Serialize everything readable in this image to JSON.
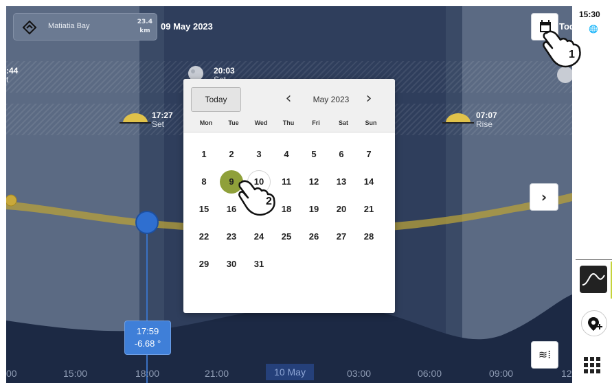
{
  "location": {
    "name": "Matiatia Bay",
    "distance_value": "23.4",
    "distance_unit": "km"
  },
  "header": {
    "date": "09 May 2023",
    "calendar_button_label": "Today"
  },
  "events": {
    "left_cut_time": ":44",
    "left_cut_label": "t",
    "moon_set_time": "20:03",
    "moon_set_label": "Set",
    "sun_set_time": "17:27",
    "sun_set_label": "Set",
    "sun_rise_time": "07:07",
    "sun_rise_label": "Rise"
  },
  "marker": {
    "time": "17:59",
    "value": "-6.68 °"
  },
  "axis": {
    "labels": [
      "00",
      "15:00",
      "18:00",
      "21:00",
      "03:00",
      "06:00",
      "09:00",
      "12"
    ],
    "date_chip": "10 May"
  },
  "calendar_popup": {
    "today_button": "Today",
    "month_label": "May 2023",
    "weekdays": [
      "Mon",
      "Tue",
      "Wed",
      "Thu",
      "Fri",
      "Sat",
      "Sun"
    ],
    "weeks": [
      [
        "1",
        "2",
        "3",
        "4",
        "5",
        "6",
        "7"
      ],
      [
        "8",
        "9",
        "10",
        "11",
        "12",
        "13",
        "14"
      ],
      [
        "15",
        "16",
        "17",
        "18",
        "19",
        "20",
        "21"
      ],
      [
        "22",
        "23",
        "24",
        "25",
        "26",
        "27",
        "28"
      ],
      [
        "29",
        "30",
        "31",
        "",
        "",
        "",
        ""
      ]
    ],
    "selected_day": "9",
    "hovered_day": "10"
  },
  "sidebar": {
    "clock": "15:30"
  },
  "annotations": {
    "step1": "1",
    "step2": "2"
  },
  "icons": {
    "location": "navigation-diamond-icon",
    "calendar": "calendar-icon",
    "next": "chevron-right-icon",
    "prev_month": "chevron-left-icon",
    "next_month": "chevron-right-icon",
    "filter": "tide-filter-icon",
    "globe": "globe-icon",
    "tide": "tide-curve-icon",
    "add_pin": "add-location-pin-icon",
    "apps": "apps-grid-icon",
    "hand": "hand-pointer-icon"
  },
  "colors": {
    "accent_selected": "#8fa03a",
    "marker": "#2f6fd0",
    "sun_curve": "#c9b53a",
    "night": "#2f3e5c"
  }
}
